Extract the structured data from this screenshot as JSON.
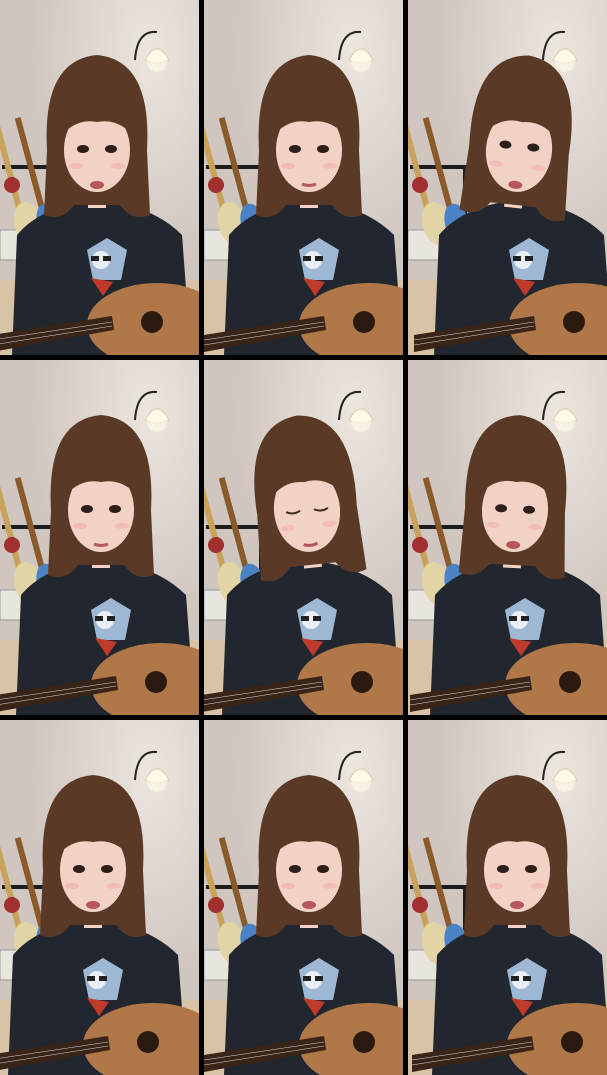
{
  "grid": {
    "columns": 3,
    "rows": 3,
    "background": "#000000"
  },
  "tiles": [
    {
      "id": 1,
      "head_tilt": 0,
      "shift": -8,
      "gaze": "camera",
      "mouth": "open"
    },
    {
      "id": 2,
      "head_tilt": 0,
      "shift": 0,
      "gaze": "camera",
      "mouth": "closed"
    },
    {
      "id": 3,
      "head_tilt": 6,
      "shift": 6,
      "gaze": "up",
      "mouth": "open"
    },
    {
      "id": 4,
      "head_tilt": 0,
      "shift": -4,
      "gaze": "camera",
      "mouth": "closed"
    },
    {
      "id": 5,
      "head_tilt": -6,
      "shift": -2,
      "gaze": "down",
      "mouth": "closed"
    },
    {
      "id": 6,
      "head_tilt": 3,
      "shift": 2,
      "gaze": "side",
      "mouth": "open"
    },
    {
      "id": 7,
      "head_tilt": 0,
      "shift": -12,
      "gaze": "camera",
      "mouth": "open"
    },
    {
      "id": 8,
      "head_tilt": 0,
      "shift": 0,
      "gaze": "camera",
      "mouth": "open"
    },
    {
      "id": 9,
      "head_tilt": 0,
      "shift": 4,
      "gaze": "camera",
      "mouth": "open"
    }
  ],
  "colors": {
    "wall": "#cfc6bf",
    "wall_light": "#ece6df",
    "floor": "#d8c3a6",
    "hair": "#5a3a26",
    "skin": "#f2d2c4",
    "shirt": "#22272f",
    "guitar_body": "#b07848",
    "guitar_neck": "#3a2418",
    "lamp": "#fff8e6"
  },
  "icons": [
    "floor-lamp-icon",
    "guitar-stand-icon",
    "acoustic-guitar-icon"
  ]
}
